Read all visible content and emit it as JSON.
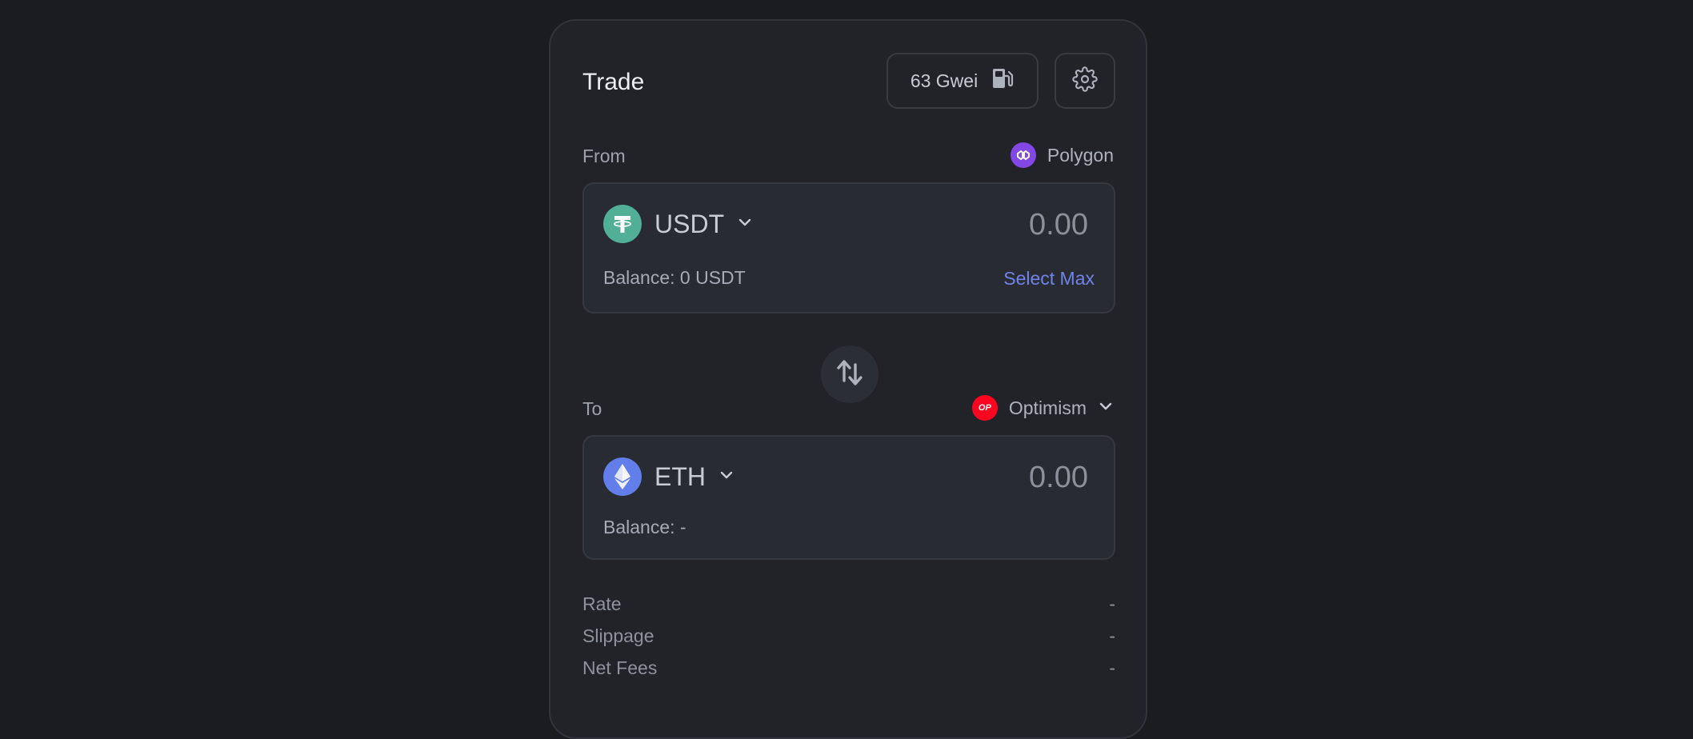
{
  "trade": {
    "title": "Trade",
    "gas_price": "63 Gwei",
    "icons": {
      "gas": "gas-pump-icon",
      "settings": "gear-icon",
      "swap": "swap-arrows-icon"
    }
  },
  "from": {
    "label": "From",
    "chain": {
      "name": "Polygon",
      "icon": "polygon-icon",
      "color": "#8247e5"
    },
    "token": {
      "symbol": "USDT",
      "icon": "tether-icon",
      "color": "#50af95"
    },
    "amount_placeholder": "0.00",
    "balance": "Balance: 0 USDT",
    "select_max": "Select Max"
  },
  "to": {
    "label": "To",
    "chain": {
      "name": "Optimism",
      "icon": "optimism-icon",
      "color": "#ff0420",
      "badge_text": "OP"
    },
    "token": {
      "symbol": "ETH",
      "icon": "ethereum-icon",
      "color": "#627eea"
    },
    "amount_placeholder": "0.00",
    "balance": "Balance: -"
  },
  "summary": [
    {
      "label": "Rate",
      "value": "-"
    },
    {
      "label": "Slippage",
      "value": "-"
    },
    {
      "label": "Net Fees",
      "value": "-"
    }
  ]
}
